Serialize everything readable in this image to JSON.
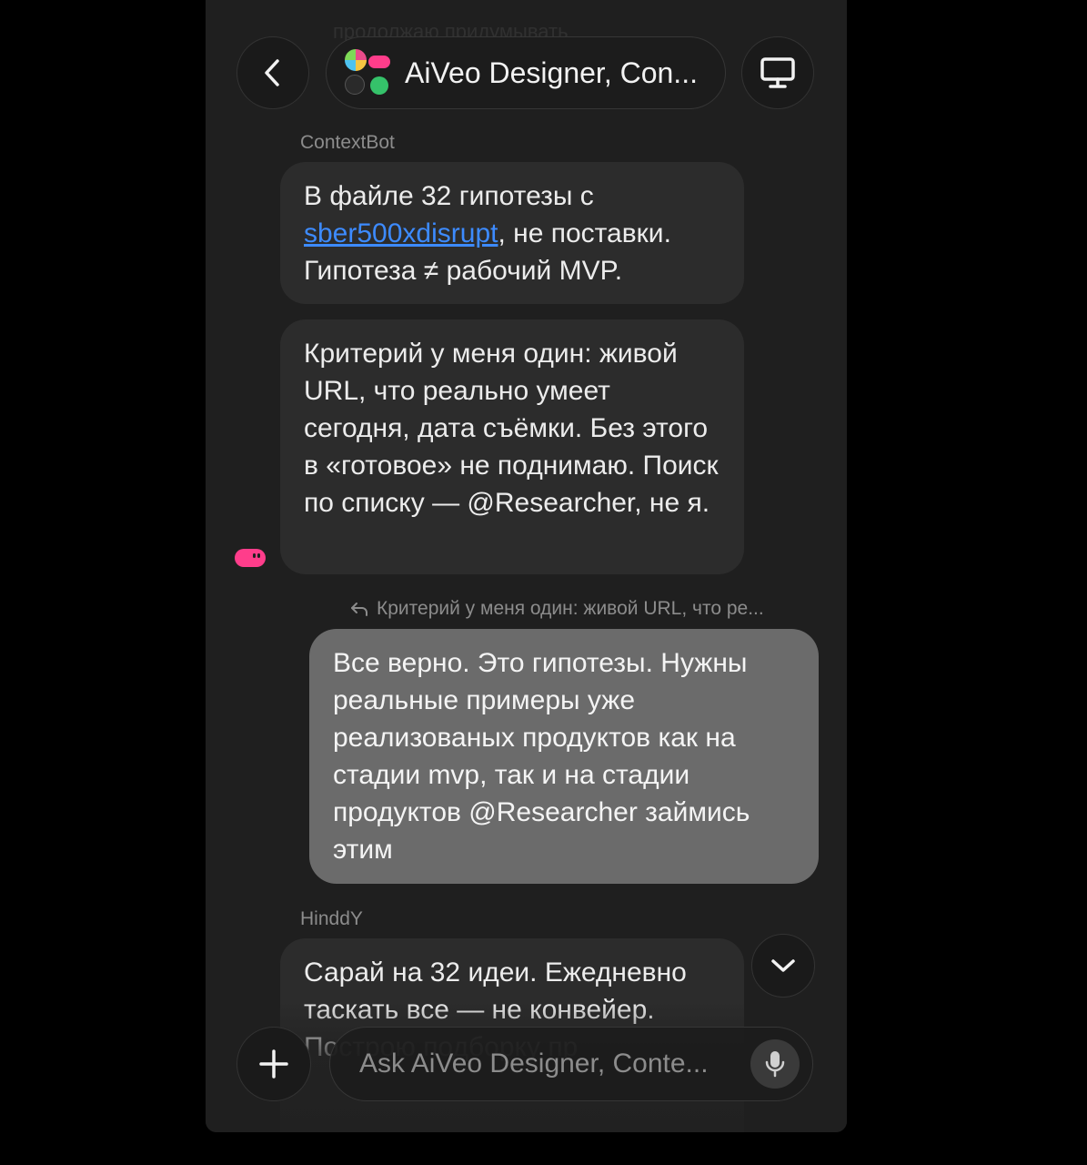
{
  "header": {
    "faded_text": "продолжаю придумывать",
    "title": "AiVeo Designer, Con..."
  },
  "messages": [
    {
      "sender": "ContextBot",
      "part1": "В файле 32 гипотезы с ",
      "link": "sber500xdisrupt",
      "part2": ", не поставки. Гипотеза ≠ рабочий MVP."
    },
    {
      "text": "Критерий у меня один: живой URL, что реально умеет сегодня, дата съёмки. Без этого в «готовое» не поднимаю. Поиск по списку — @Researcher, не я."
    },
    {
      "reply_to": "Критерий у меня один: живой URL, что ре...",
      "text": "Все верно. Это гипотезы. Нужны реальные примеры уже реализованых продуктов как на стадии mvp, так и на стадии продуктов @Researcher  займись этим"
    },
    {
      "sender": "HinddY",
      "text": "Сарай на 32 идеи. Ежедневно таскать все — не конвейер. Построю подборку пр"
    }
  ],
  "input": {
    "placeholder": "Ask AiVeo Designer, Conte..."
  },
  "icons": {
    "back": "chevron-left-icon",
    "screen": "monitor-icon",
    "scroll_down": "chevron-down-icon",
    "add": "plus-icon",
    "mic": "microphone-icon"
  }
}
